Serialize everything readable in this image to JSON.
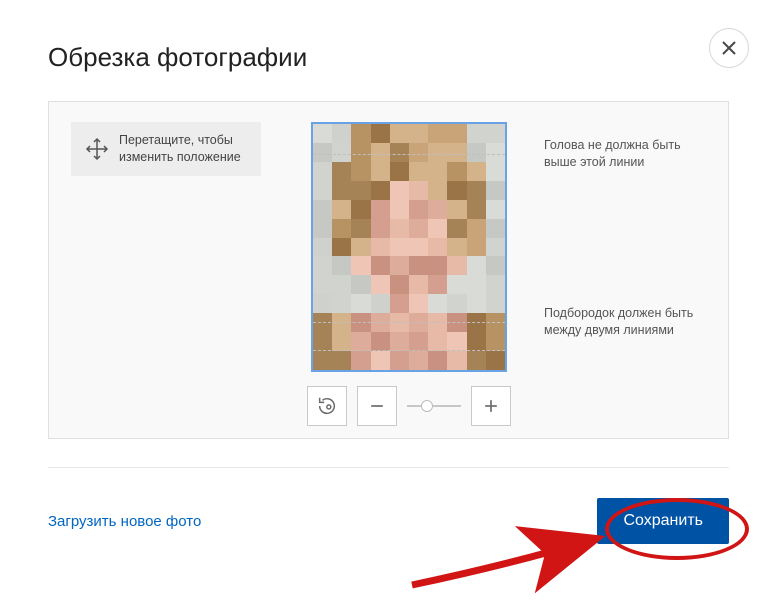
{
  "title": "Обрезка фотографии",
  "close_label": "close",
  "drag_hint": "Перетащите, чтобы изменить положение",
  "guideline_top_line1": "Голова не должна быть",
  "guideline_top_line2": "выше этой линии",
  "guideline_bottom_line1": "Подбородок должен быть",
  "guideline_bottom_line2": "между двумя линиями",
  "controls": {
    "rotate": "rotate",
    "zoom_out": "-",
    "zoom_in": "+"
  },
  "footer": {
    "upload_new": "Загрузить новое фото",
    "save": "Сохранить"
  },
  "colors": {
    "accent": "#0052a5",
    "link": "#0066c3",
    "frame": "#6aa2e6",
    "annotation": "#d11515"
  }
}
